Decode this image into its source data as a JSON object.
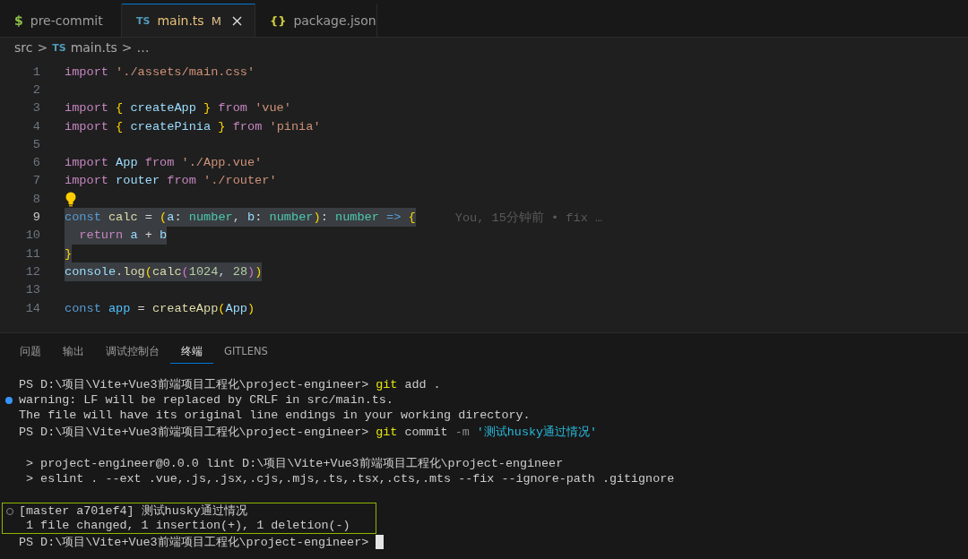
{
  "tabs": [
    {
      "icon": "$",
      "label": "pre-commit",
      "selected": false,
      "modified": false
    },
    {
      "icon": "TS",
      "label": "main.ts",
      "selected": true,
      "badge": "M",
      "modified": true
    },
    {
      "icon": "{}",
      "label": "package.json",
      "selected": false,
      "modified": false
    }
  ],
  "breadcrumb": {
    "folder": "src",
    "separator": ">",
    "file_icon": "TS",
    "file": "main.ts",
    "more": "…"
  },
  "editor": {
    "lines": [
      {
        "number": "1",
        "selected": false,
        "tokens": [
          {
            "t": "import ",
            "kind": "kw"
          },
          {
            "t": "'./assets/main.css'",
            "kind": "str"
          }
        ]
      },
      {
        "number": "2",
        "selected": false
      },
      {
        "number": "3",
        "selected": false,
        "tokens": [
          {
            "t": "import ",
            "kind": "kw"
          },
          {
            "t": "{ ",
            "kind": "brace"
          },
          {
            "t": "createApp ",
            "kind": "var"
          },
          {
            "t": "} ",
            "kind": "brace"
          },
          {
            "t": "from ",
            "kind": "kw"
          },
          {
            "t": "'vue'",
            "kind": "str"
          }
        ]
      },
      {
        "number": "4",
        "selected": false,
        "tokens": [
          {
            "t": "import ",
            "kind": "kw"
          },
          {
            "t": "{ ",
            "kind": "brace"
          },
          {
            "t": "createPinia ",
            "kind": "var"
          },
          {
            "t": "} ",
            "kind": "brace"
          },
          {
            "t": "from ",
            "kind": "kw"
          },
          {
            "t": "'pinia'",
            "kind": "str"
          }
        ]
      },
      {
        "number": "5",
        "selected": false
      },
      {
        "number": "6",
        "selected": false,
        "tokens": [
          {
            "t": "import ",
            "kind": "kw"
          },
          {
            "t": "App ",
            "kind": "var"
          },
          {
            "t": "from ",
            "kind": "kw"
          },
          {
            "t": "'./App.vue'",
            "kind": "str"
          }
        ]
      },
      {
        "number": "7",
        "selected": false,
        "tokens": [
          {
            "t": "import ",
            "kind": "kw"
          },
          {
            "t": "router ",
            "kind": "var"
          },
          {
            "t": "from ",
            "kind": "kw"
          },
          {
            "t": "'./router'",
            "kind": "str"
          }
        ]
      },
      {
        "number": "8",
        "selected": false,
        "lightbulb": true
      },
      {
        "number": "9",
        "selected": true,
        "current": true,
        "blame": "You, 15分钟前 • fix …",
        "tokens": [
          {
            "t": "const ",
            "kind": "decl"
          },
          {
            "t": "calc ",
            "kind": "func"
          },
          {
            "t": "= ",
            "kind": "plain"
          },
          {
            "t": "(",
            "kind": "brace"
          },
          {
            "t": "a",
            "kind": "var"
          },
          {
            "t": ": ",
            "kind": "plain"
          },
          {
            "t": "number",
            "kind": "type"
          },
          {
            "t": ", ",
            "kind": "plain"
          },
          {
            "t": "b",
            "kind": "var"
          },
          {
            "t": ": ",
            "kind": "plain"
          },
          {
            "t": "number",
            "kind": "type"
          },
          {
            "t": ")",
            "kind": "brace"
          },
          {
            "t": ": ",
            "kind": "plain"
          },
          {
            "t": "number ",
            "kind": "type"
          },
          {
            "t": "=> ",
            "kind": "decl"
          },
          {
            "t": "{",
            "kind": "brace"
          }
        ]
      },
      {
        "number": "10",
        "selected": true,
        "tokens": [
          {
            "t": "  return ",
            "kind": "kw"
          },
          {
            "t": "a ",
            "kind": "var"
          },
          {
            "t": "+ ",
            "kind": "plain"
          },
          {
            "t": "b",
            "kind": "var"
          }
        ]
      },
      {
        "number": "11",
        "selected": true,
        "tokens": [
          {
            "t": "}",
            "kind": "brace"
          }
        ]
      },
      {
        "number": "12",
        "selected": true,
        "tokens": [
          {
            "t": "console",
            "kind": "var"
          },
          {
            "t": ".",
            "kind": "plain"
          },
          {
            "t": "log",
            "kind": "func"
          },
          {
            "t": "(",
            "kind": "brace"
          },
          {
            "t": "calc",
            "kind": "func"
          },
          {
            "t": "(",
            "kind": "paren"
          },
          {
            "t": "1024",
            "kind": "num"
          },
          {
            "t": ", ",
            "kind": "plain"
          },
          {
            "t": "28",
            "kind": "num"
          },
          {
            "t": ")",
            "kind": "paren"
          },
          {
            "t": ")",
            "kind": "brace"
          }
        ]
      },
      {
        "number": "13",
        "selected": false
      },
      {
        "number": "14",
        "selected": false,
        "tokens": [
          {
            "t": "const ",
            "kind": "decl"
          },
          {
            "t": "app ",
            "kind": "const"
          },
          {
            "t": "= ",
            "kind": "plain"
          },
          {
            "t": "createApp",
            "kind": "func"
          },
          {
            "t": "(",
            "kind": "brace"
          },
          {
            "t": "App",
            "kind": "var"
          },
          {
            "t": ")",
            "kind": "brace"
          }
        ]
      }
    ]
  },
  "panel_tabs": [
    {
      "label": "问题",
      "selected": false
    },
    {
      "label": "输出",
      "selected": false
    },
    {
      "label": "调试控制台",
      "selected": false
    },
    {
      "label": "终端",
      "selected": true
    },
    {
      "label": "GITLENS",
      "selected": false
    }
  ],
  "terminal": [
    {
      "kind": "output",
      "boxed": false,
      "segments": [
        {
          "t": "PS D:\\项目\\Vite+Vue3前端项目工程化\\project-engineer> ",
          "kind": "plain"
        },
        {
          "t": "git",
          "kind": "cmd"
        },
        {
          "t": " add .",
          "kind": "plain"
        }
      ]
    },
    {
      "kind": "warning",
      "boxed": false,
      "segments": [
        {
          "t": "warning: LF will be replaced by CRLF in src/main.ts.",
          "kind": "plain"
        }
      ]
    },
    {
      "kind": "output",
      "boxed": false,
      "segments": [
        {
          "t": "The file will have its original line endings in your working directory.",
          "kind": "plain"
        }
      ]
    },
    {
      "kind": "output",
      "boxed": false,
      "segments": [
        {
          "t": "PS D:\\项目\\Vite+Vue3前端项目工程化\\project-engineer> ",
          "kind": "plain"
        },
        {
          "t": "git",
          "kind": "cmd"
        },
        {
          "t": " commit ",
          "kind": "plain"
        },
        {
          "t": "-m",
          "kind": "flag"
        },
        {
          "t": " '测试husky通过情况'",
          "kind": "str"
        }
      ]
    },
    {
      "kind": "output",
      "boxed": false
    },
    {
      "kind": "output",
      "boxed": false,
      "segments": [
        {
          "t": " > project-engineer@0.0.0 lint D:\\项目\\Vite+Vue3前端项目工程化\\project-engineer",
          "kind": "plain"
        }
      ]
    },
    {
      "kind": "output",
      "boxed": false,
      "segments": [
        {
          "t": " > eslint . --ext .vue,.js,.jsx,.cjs,.mjs,.ts,.tsx,.cts,.mts --fix --ignore-path .gitignore",
          "kind": "plain"
        }
      ]
    },
    {
      "kind": "output",
      "boxed": false
    },
    {
      "kind": "result",
      "boxed": true,
      "segments": [
        {
          "t": "[master a701ef4] 测试husky通过情况",
          "kind": "plain"
        }
      ]
    },
    {
      "kind": "output",
      "boxed": true,
      "segments": [
        {
          "t": " 1 file changed, 1 insertion(+), 1 deletion(-)",
          "kind": "plain"
        }
      ]
    },
    {
      "kind": "output",
      "boxed": false,
      "cursor": true,
      "segments": [
        {
          "t": "PS D:\\项目\\Vite+Vue3前端项目工程化\\project-engineer> ",
          "kind": "plain"
        }
      ]
    }
  ]
}
